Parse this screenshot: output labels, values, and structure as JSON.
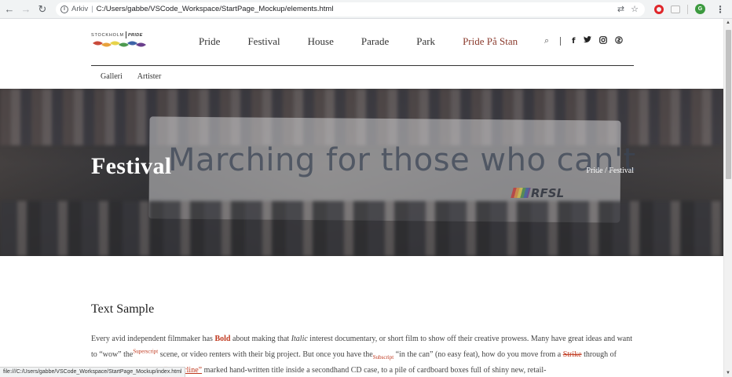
{
  "browser": {
    "back_icon": "arrow-left-icon",
    "forward_icon": "arrow-right-icon",
    "reload_icon": "reload-icon",
    "info_icon": "info-icon",
    "url_prefix": "Arkiv",
    "url_separator": "|",
    "url": "C:/Users/gabbe/VSCode_Workspace/StartPage_Mockup/elements.html",
    "avatar_letter": "G",
    "status_url": "file:///C:/Users/gabbe/VSCode_Workspace/StartPage_Mockup/index.html"
  },
  "site": {
    "logo_stockholm": "STOCKHOLM",
    "logo_pride": "PRIDE",
    "logo_colors": [
      "#c94a3a",
      "#e8a23c",
      "#e7d34a",
      "#4d9a50",
      "#3e64a8",
      "#6a3f8c"
    ],
    "nav": [
      {
        "label": "Pride",
        "active": false
      },
      {
        "label": "Festival",
        "active": false
      },
      {
        "label": "House",
        "active": false
      },
      {
        "label": "Parade",
        "active": false
      },
      {
        "label": "Park",
        "active": false
      },
      {
        "label": "Pride På Stan",
        "active": true
      }
    ],
    "icons": {
      "search": "⌕",
      "facebook": "f",
      "twitter": "🐦",
      "instagram": "◎",
      "other": "⑤"
    },
    "subnav": [
      "Galleri",
      "Artister"
    ]
  },
  "hero": {
    "title": "Festival",
    "breadcrumb": "Pride / Festival",
    "banner_text": "Marching for those who can't",
    "banner_org": "RFSL"
  },
  "content": {
    "section_title": "Text Sample",
    "p1": "Every avid independent filmmaker has ",
    "bold": "Bold",
    "p2": " about making that ",
    "italic": "Italic",
    "p3": " interest documentary, or short film to show off their creative prowess. Many have great ideas and want to “wow” the",
    "superscript": "Superscript",
    "p4": " scene, or video renters with their big project. But once you have the",
    "subscript": "Subscript",
    "p5": " “in the can” (no easy feat), how do you move from a ",
    "strike": "Strike",
    "p6": " through of master DVDs with the ",
    "underline": "“Underline”",
    "p7": " marked hand-written title inside a secondhand CD case, to a pile of cardboard boxes full of shiny new, retail-"
  }
}
